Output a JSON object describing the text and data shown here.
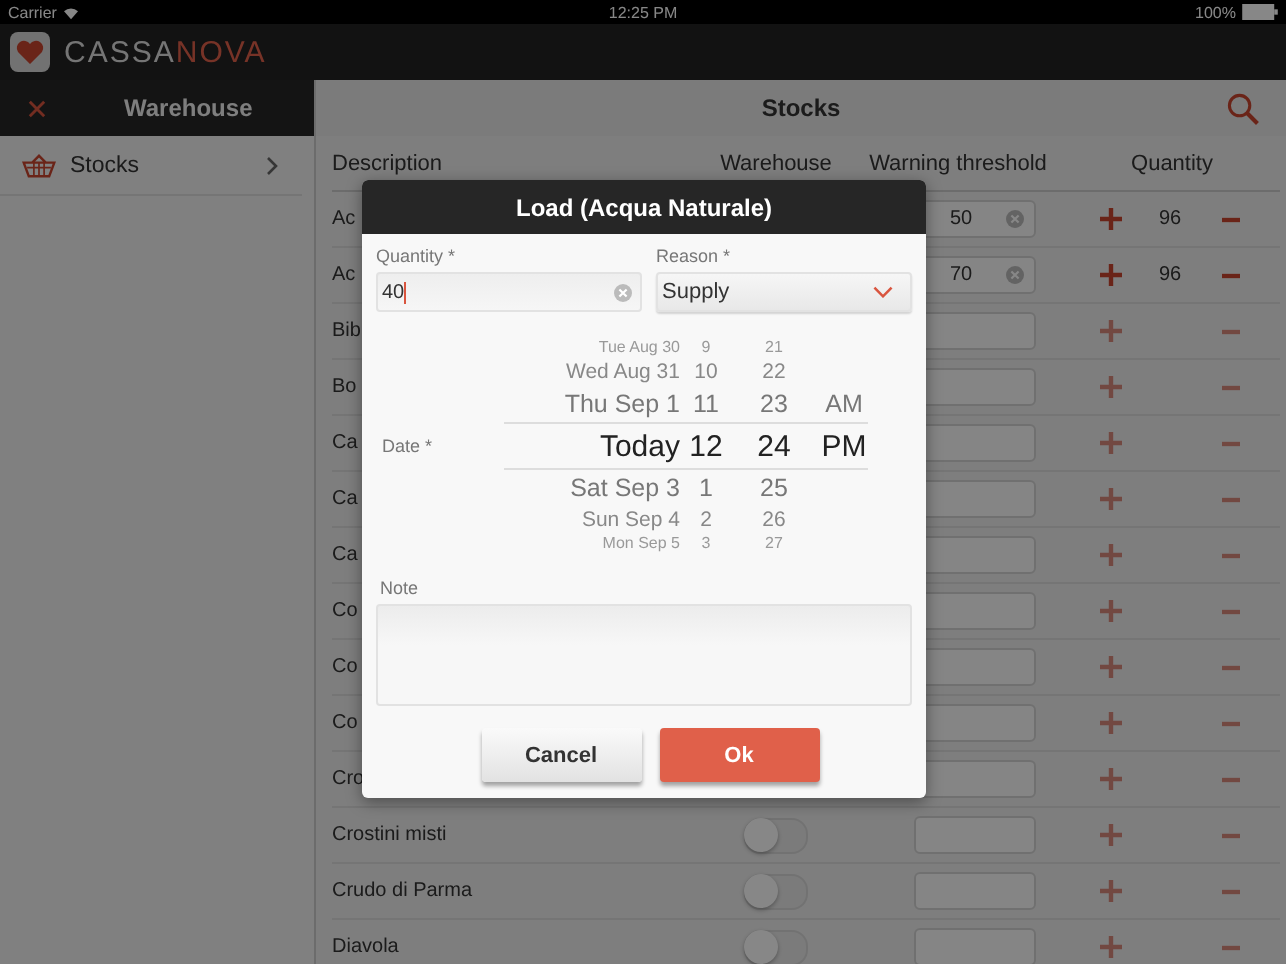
{
  "status_bar": {
    "carrier": "Carrier",
    "time": "12:25 PM",
    "battery": "100%"
  },
  "brand": {
    "part_a": "CASSA",
    "part_b": "NOVA"
  },
  "sidebar": {
    "title": "Warehouse",
    "items": [
      {
        "label": "Stocks"
      }
    ]
  },
  "main": {
    "title": "Stocks"
  },
  "table": {
    "columns": [
      "Description",
      "Warehouse",
      "Warning threshold",
      "Quantity"
    ],
    "rows": [
      {
        "description": "Ac",
        "threshold": "50",
        "quantity": "96",
        "active": true
      },
      {
        "description": "Ac",
        "threshold": "70",
        "quantity": "96",
        "active": true
      },
      {
        "description": "Bib",
        "active": false
      },
      {
        "description": "Bo",
        "active": false
      },
      {
        "description": "Ca",
        "active": false
      },
      {
        "description": "Ca",
        "active": false
      },
      {
        "description": "Ca",
        "active": false
      },
      {
        "description": "Co",
        "active": false
      },
      {
        "description": "Co",
        "active": false
      },
      {
        "description": "Co",
        "active": false
      },
      {
        "description": "Cro",
        "active": false
      },
      {
        "description": "Crostini misti",
        "warehouse_on": false,
        "active": false
      },
      {
        "description": "Crudo di Parma",
        "warehouse_on": false,
        "active": false
      },
      {
        "description": "Diavola",
        "warehouse_on": false,
        "active": false
      }
    ]
  },
  "dialog": {
    "title": "Load (Acqua Naturale)",
    "quantity": {
      "label": "Quantity *",
      "value": "40"
    },
    "reason": {
      "label": "Reason *",
      "value": "Supply"
    },
    "date": {
      "label": "Date *",
      "rows": [
        {
          "date": "Tue Aug 30",
          "hour": "9",
          "minute": "21",
          "selected": false
        },
        {
          "date": "Wed Aug 31",
          "hour": "10",
          "minute": "22",
          "selected": false
        },
        {
          "date": "Thu Sep 1",
          "hour": "11",
          "minute": "23",
          "ampm": "AM",
          "selected": false
        },
        {
          "date": "Today",
          "hour": "12",
          "minute": "24",
          "ampm": "PM",
          "selected": true
        },
        {
          "date": "Sat Sep 3",
          "hour": "1",
          "minute": "25",
          "selected": false
        },
        {
          "date": "Sun Sep 4",
          "hour": "2",
          "minute": "26",
          "selected": false
        },
        {
          "date": "Mon Sep 5",
          "hour": "3",
          "minute": "27",
          "selected": false
        }
      ]
    },
    "note": {
      "label": "Note"
    },
    "buttons": [
      {
        "label": "Cancel",
        "kind": "secondary"
      },
      {
        "label": "Ok",
        "kind": "primary"
      }
    ]
  }
}
